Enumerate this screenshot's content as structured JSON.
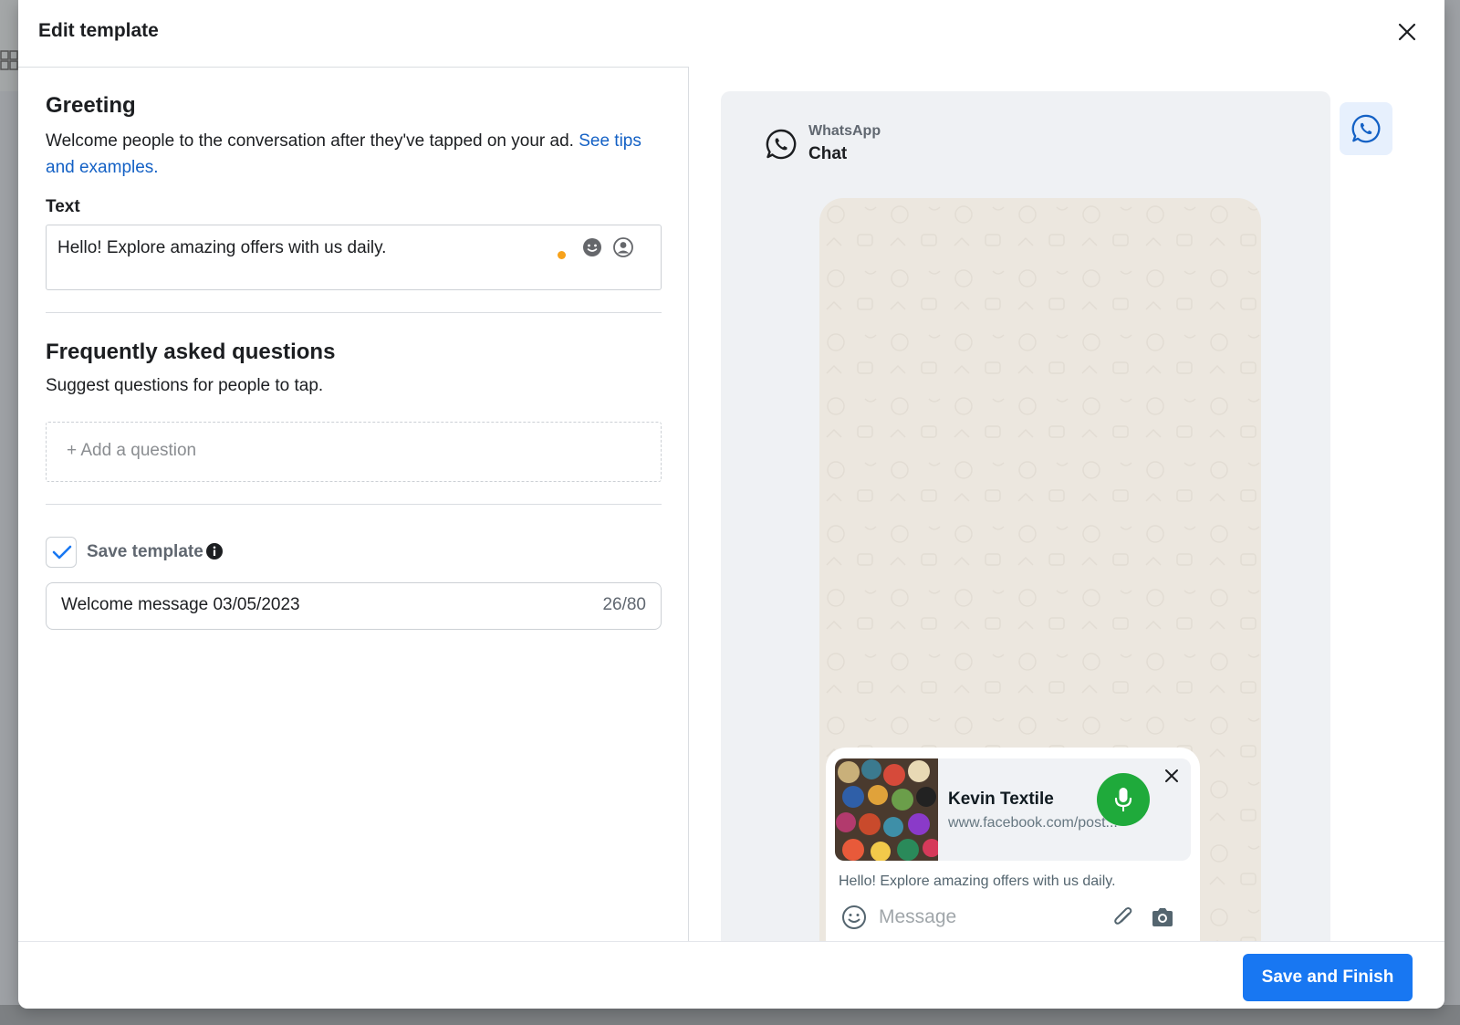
{
  "modal": {
    "title": "Edit template"
  },
  "greeting": {
    "title": "Greeting",
    "description": "Welcome people to the conversation after they've tapped on your ad.",
    "link": "See tips and examples.",
    "text_label": "Text",
    "text_value": "Hello! Explore amazing offers with us daily.",
    "icons": [
      "emoji-icon",
      "personalize-icon"
    ]
  },
  "faq": {
    "title": "Frequently asked questions",
    "description": "Suggest questions for people to tap.",
    "add_label": "+ Add a question"
  },
  "save_template": {
    "checked": true,
    "label": "Save template",
    "name_value": "Welcome message 03/05/2023",
    "char_count": "26/80"
  },
  "preview": {
    "app_name": "WhatsApp",
    "chat_label": "Chat",
    "link_card": {
      "title": "Kevin Textile",
      "url": "www.facebook.com/post..."
    },
    "message": "Hello! Explore amazing offers with us daily.",
    "compose_placeholder": "Message",
    "colors": {
      "whatsapp_green": "#1faa3b",
      "chat_bg": "#ece7df"
    }
  },
  "footer": {
    "primary_label": "Save and Finish",
    "primary_color": "#1877f2"
  }
}
